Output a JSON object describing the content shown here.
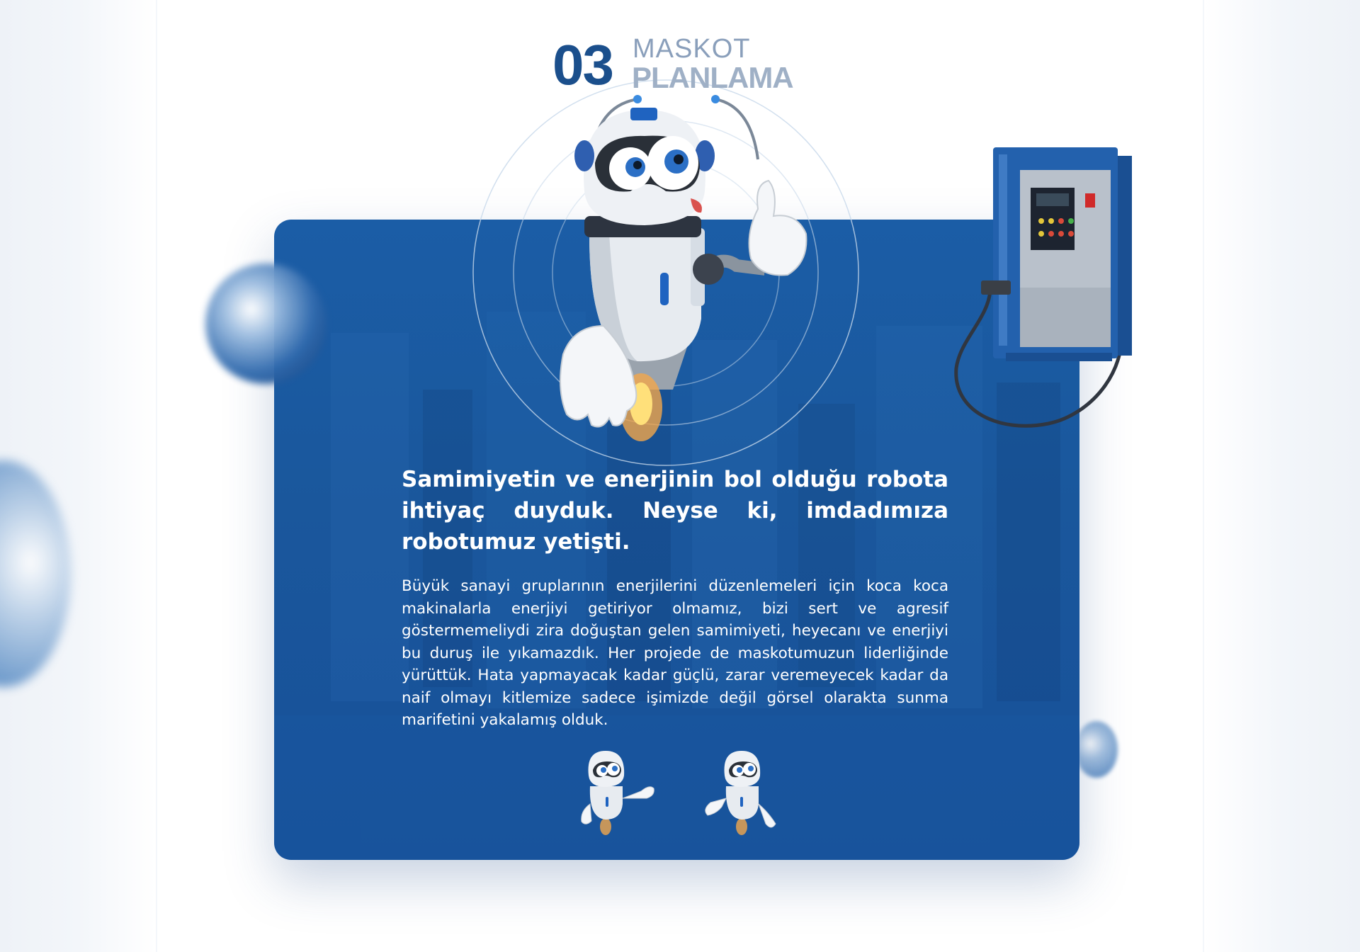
{
  "section": {
    "step_number": "03",
    "kicker": "MASKOT",
    "title": "PLANLAMA"
  },
  "card": {
    "headline": "Samimiyetin ve enerjinin bol olduğu robota ihtiyaç duyduk. Neyse ki, imdadımıza robotumuz yetişti.",
    "body": "Büyük sanayi gruplarının enerjilerini düzenlemeleri için koca koca makinalarla enerjiyi getiriyor olmamız, bizi sert ve agresif göstermemeliydi zira doğuştan gelen samimiyeti, heyecanı ve enerjiyi bu duruş ile yıkamazdık. Her projede de maskotumuzun liderliğinde yürüttük. Hata yapmayacak kadar güçlü, zarar veremeyecek kadar da naif olmayı kitlemize sadece işimizde değil görsel olarakta sunma marifetini yakalamış olduk."
  },
  "colors": {
    "card_blue": "#1a579c",
    "number_blue": "#1b4f8c",
    "kicker_gray": "#8a9fbb"
  },
  "icons": [
    "robot-mascot",
    "battery-charger",
    "mini-robot-mascot"
  ]
}
